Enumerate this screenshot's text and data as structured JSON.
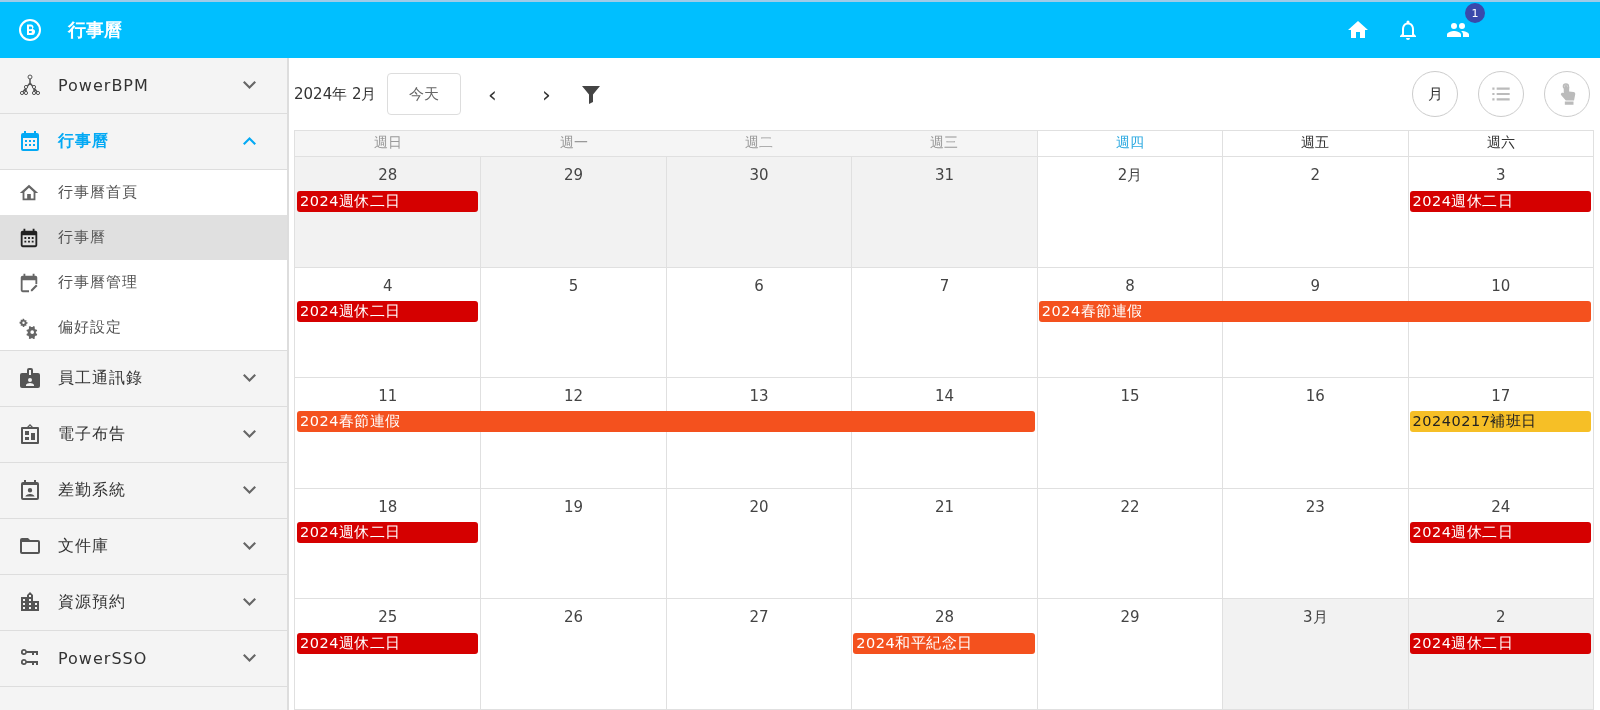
{
  "app_bar": {
    "title": "行事曆",
    "notification_count": "1"
  },
  "sidebar": {
    "items": [
      {
        "label": "PowerBPM",
        "expanded": false,
        "active": false
      },
      {
        "label": "行事曆",
        "expanded": true,
        "active": true,
        "children": [
          {
            "label": "行事曆首頁",
            "selected": false
          },
          {
            "label": "行事曆",
            "selected": true
          },
          {
            "label": "行事曆管理",
            "selected": false
          },
          {
            "label": "偏好設定",
            "selected": false
          }
        ]
      },
      {
        "label": "員工通訊錄",
        "expanded": false,
        "active": false
      },
      {
        "label": "電子布告",
        "expanded": false,
        "active": false
      },
      {
        "label": "差勤系統",
        "expanded": false,
        "active": false
      },
      {
        "label": "文件庫",
        "expanded": false,
        "active": false
      },
      {
        "label": "資源預約",
        "expanded": false,
        "active": false
      },
      {
        "label": "PowerSSO",
        "expanded": false,
        "active": false
      }
    ]
  },
  "toolbar": {
    "period": "2024年 2月",
    "today_button": "今天",
    "prev": "‹",
    "next": "›",
    "view_button": "月"
  },
  "calendar": {
    "weekdays": [
      {
        "label": "週日",
        "shaded": true,
        "highlighted": false
      },
      {
        "label": "週一",
        "shaded": true,
        "highlighted": false
      },
      {
        "label": "週二",
        "shaded": true,
        "highlighted": false
      },
      {
        "label": "週三",
        "shaded": true,
        "highlighted": false
      },
      {
        "label": "週四",
        "shaded": false,
        "highlighted": true
      },
      {
        "label": "週五",
        "shaded": false,
        "highlighted": false
      },
      {
        "label": "週六",
        "shaded": false,
        "highlighted": false
      }
    ],
    "weeks": [
      {
        "days": [
          {
            "date": "28",
            "outside": true,
            "event": {
              "title": "2024週休二日",
              "color": "#d50000"
            }
          },
          {
            "date": "29",
            "outside": true
          },
          {
            "date": "30",
            "outside": true
          },
          {
            "date": "31",
            "outside": true
          },
          {
            "date": "2月",
            "outside": false
          },
          {
            "date": "2",
            "outside": false
          },
          {
            "date": "3",
            "outside": false,
            "event": {
              "title": "2024週休二日",
              "color": "#d50000"
            }
          }
        ]
      },
      {
        "days": [
          {
            "date": "4",
            "outside": false,
            "event": {
              "title": "2024週休二日",
              "color": "#d50000"
            }
          },
          {
            "date": "5",
            "outside": false
          },
          {
            "date": "6",
            "outside": false
          },
          {
            "date": "7",
            "outside": false
          },
          {
            "date": "8",
            "outside": false,
            "event": {
              "title": "2024春節連假",
              "color": "#f4511e"
            }
          },
          {
            "date": "9",
            "outside": false,
            "event_continues": true
          },
          {
            "date": "10",
            "outside": false,
            "event_continues": true
          }
        ]
      },
      {
        "days": [
          {
            "date": "11",
            "outside": false,
            "event": {
              "title": "2024春節連假",
              "color": "#f4511e"
            }
          },
          {
            "date": "12",
            "outside": false,
            "event_continues": true
          },
          {
            "date": "13",
            "outside": false,
            "event_continues": true
          },
          {
            "date": "14",
            "outside": false,
            "event_continues": true
          },
          {
            "date": "15",
            "outside": false
          },
          {
            "date": "16",
            "outside": false
          },
          {
            "date": "17",
            "outside": false,
            "event": {
              "title": "20240217補班日",
              "color": "#f6bf26"
            }
          }
        ]
      },
      {
        "days": [
          {
            "date": "18",
            "outside": false,
            "event": {
              "title": "2024週休二日",
              "color": "#d50000"
            }
          },
          {
            "date": "19",
            "outside": false
          },
          {
            "date": "20",
            "outside": false
          },
          {
            "date": "21",
            "outside": false
          },
          {
            "date": "22",
            "outside": false
          },
          {
            "date": "23",
            "outside": false
          },
          {
            "date": "24",
            "outside": false,
            "event": {
              "title": "2024週休二日",
              "color": "#d50000"
            }
          }
        ]
      },
      {
        "days": [
          {
            "date": "25",
            "outside": false,
            "event": {
              "title": "2024週休二日",
              "color": "#d50000"
            }
          },
          {
            "date": "26",
            "outside": false
          },
          {
            "date": "27",
            "outside": false
          },
          {
            "date": "28",
            "outside": false,
            "event": {
              "title": "2024和平紀念日",
              "color": "#f4511e"
            }
          },
          {
            "date": "29",
            "outside": false
          },
          {
            "date": "3月",
            "outside": true
          },
          {
            "date": "2",
            "outside": true,
            "event": {
              "title": "2024週休二日",
              "color": "#d50000"
            }
          }
        ]
      }
    ]
  }
}
